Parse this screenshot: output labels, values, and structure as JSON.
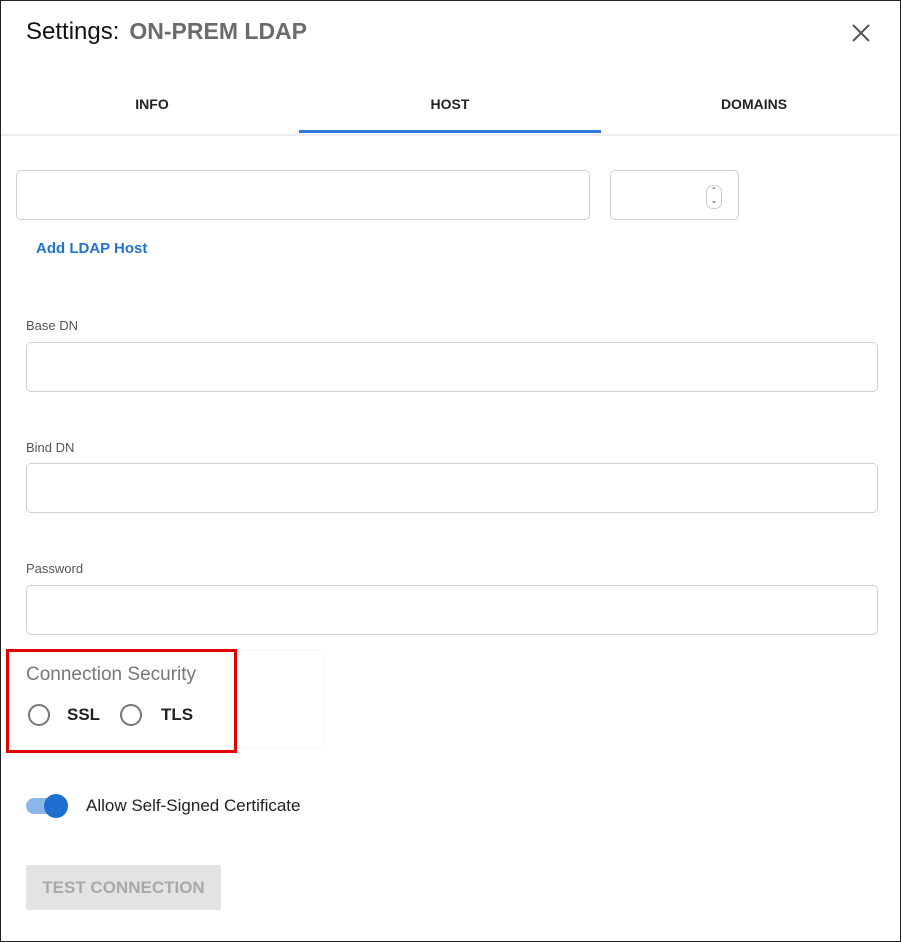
{
  "dialog": {
    "title": "Settings:",
    "subtitle": "ON-PREM LDAP",
    "close_icon": "close-icon"
  },
  "tabs": [
    {
      "label": "INFO",
      "active": false
    },
    {
      "label": "HOST",
      "active": true
    },
    {
      "label": "DOMAINS",
      "active": false
    }
  ],
  "host": {
    "hostname_value": "",
    "port_value": "",
    "add_host_label": "Add LDAP Host"
  },
  "fields": {
    "base_dn_label": "Base DN",
    "base_dn_value": "",
    "bind_dn_label": "Bind DN",
    "bind_dn_value": "",
    "password_label": "Password",
    "password_value": ""
  },
  "security": {
    "label": "Connection Security",
    "options": [
      {
        "label": "SSL",
        "selected": false
      },
      {
        "label": "TLS",
        "selected": false
      }
    ]
  },
  "self_signed": {
    "label": "Allow Self-Signed Certificate",
    "enabled": true
  },
  "test_button": {
    "label": "TEST CONNECTION",
    "disabled": true
  },
  "colors": {
    "accent": "#2f7ad8",
    "highlight": "#e00000"
  }
}
